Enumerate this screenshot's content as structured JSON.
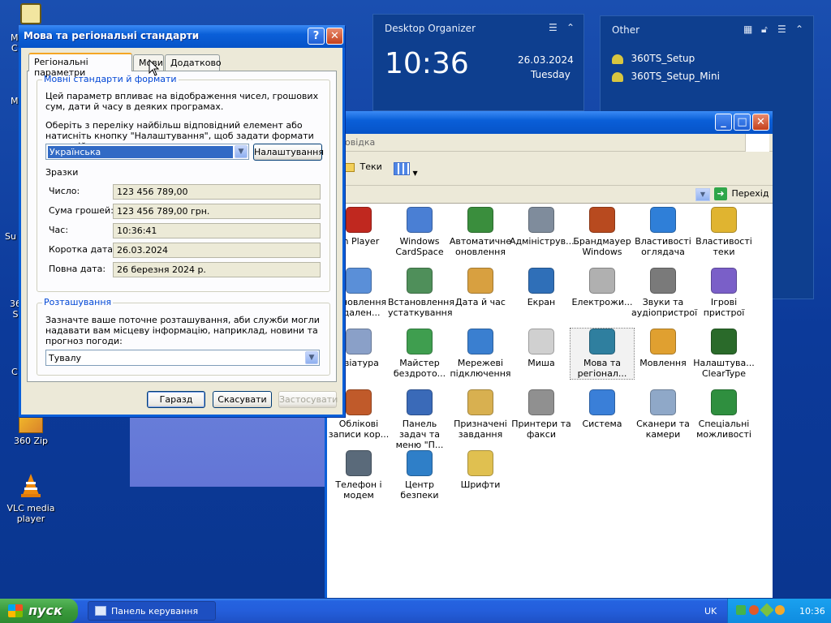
{
  "desktop_icons": [
    {
      "label": "M\nC"
    },
    {
      "label": "M"
    },
    {
      "label": "Su"
    },
    {
      "label": "36\nS"
    },
    {
      "label": "C"
    },
    {
      "label": "360 Zip"
    },
    {
      "label": "VLC media\nplayer"
    }
  ],
  "widgets": {
    "organizer": {
      "title": "Desktop Organizer",
      "time": "10:36",
      "date": "26.03.2024",
      "weekday": "Tuesday"
    },
    "other": {
      "title": "Other",
      "items": [
        "360TS_Setup",
        "360TS_Setup_Mini"
      ]
    }
  },
  "control_panel": {
    "menu_partial": "овідка",
    "toolbar_views": "Теки",
    "go_label": "Перехід",
    "items": [
      {
        "label": "sh Player"
      },
      {
        "label": "Windows CardSpace"
      },
      {
        "label": "Автоматичне оновлення"
      },
      {
        "label": "Адмініструв..."
      },
      {
        "label": "Брандмауер Windows"
      },
      {
        "label": "Властивості оглядача"
      },
      {
        "label": "Властивості теки"
      },
      {
        "label": "тановлення идален..."
      },
      {
        "label": "Встановлення устаткування"
      },
      {
        "label": "Дата й час"
      },
      {
        "label": "Екран"
      },
      {
        "label": "Електрожи..."
      },
      {
        "label": "Звуки та аудіопристрої"
      },
      {
        "label": "Ігрові пристрої"
      },
      {
        "label": "авіатура"
      },
      {
        "label": "Майстер бездрото..."
      },
      {
        "label": "Мережеві підключення"
      },
      {
        "label": "Миша"
      },
      {
        "label": "Мова та регіонал..."
      },
      {
        "label": "Мовлення"
      },
      {
        "label": "Налаштува... ClearType"
      },
      {
        "label": "Облікові записи кор..."
      },
      {
        "label": "Панель задач та меню \"П..."
      },
      {
        "label": "Призначені завдання"
      },
      {
        "label": "Принтери та факси"
      },
      {
        "label": "Система"
      },
      {
        "label": "Сканери та камери"
      },
      {
        "label": "Спеціальні можливості"
      },
      {
        "label": "Телефон і модем"
      },
      {
        "label": "Центр безпеки"
      },
      {
        "label": "Шрифти"
      }
    ]
  },
  "dialog": {
    "title": "Мова та регіональні стандарти",
    "tabs": [
      "Регіональні параметри",
      "Мови",
      "Додатково"
    ],
    "standards": {
      "legend": "Мовні стандарти й формати",
      "desc": "Цей параметр впливає на відображення чисел, грошових сум, дати й часу в деяких програмах.",
      "choose": "Оберіть з переліку найбільш відповідний елемент або натисніть кнопку \"Налаштування\", щоб задати формати самостійно:",
      "selected": "Українська",
      "customize": "Налаштування",
      "samples_label": "Зразки",
      "samples": [
        {
          "label": "Число:",
          "value": "123 456 789,00"
        },
        {
          "label": "Сума грошей:",
          "value": "123 456 789,00 грн."
        },
        {
          "label": "Час:",
          "value": "10:36:41"
        },
        {
          "label": "Коротка дата:",
          "value": "26.03.2024"
        },
        {
          "label": "Повна дата:",
          "value": "26 березня 2024 р."
        }
      ]
    },
    "location": {
      "legend": "Розташування",
      "desc": "Зазначте ваше поточне розташування, аби служби могли надавати вам місцеву інформацію, наприклад, новини та прогноз погоди:",
      "selected": "Тувалу"
    },
    "buttons": {
      "ok": "Гаразд",
      "cancel": "Скасувати",
      "apply": "Застосувати"
    }
  },
  "taskbar": {
    "start": "пуск",
    "item": "Панель керування",
    "lang": "UK",
    "clock": "10:36"
  }
}
